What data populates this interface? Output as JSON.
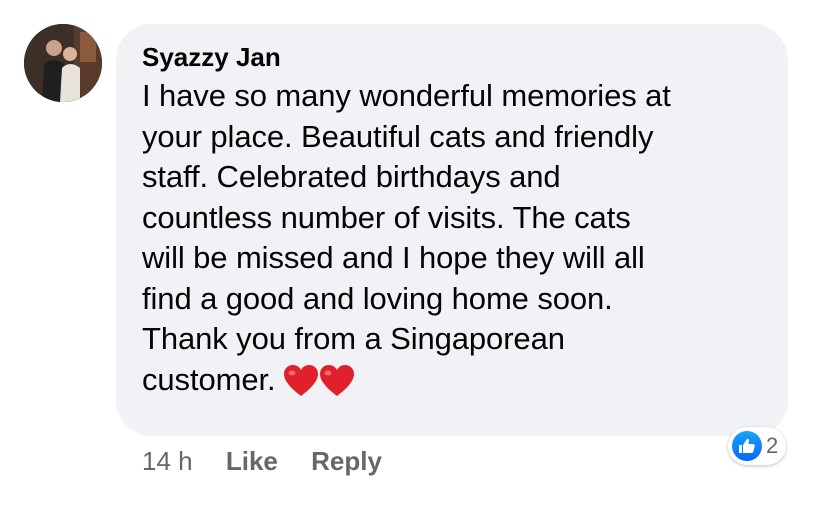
{
  "comment": {
    "author": "Syazzy Jan",
    "text": "I have so many wonderful memories at\nyour place. Beautiful cats and friendly\nstaff. Celebrated birthdays and\ncountless number of visits. The cats\nwill be missed and I hope they will all\nfind a good and loving home soon.\nThank you from a Singaporean\ncustomer.",
    "emoji": "heart-emoji x2",
    "time": "14 h",
    "like_label": "Like",
    "reply_label": "Reply",
    "reaction_count": "2",
    "reaction_type": "like-icon"
  },
  "colors": {
    "bubble_bg": "#f0f2f5",
    "text": "#050505",
    "meta_text": "#65676b",
    "like_blue": "#0866ff",
    "heart_red": "#e0202b"
  }
}
